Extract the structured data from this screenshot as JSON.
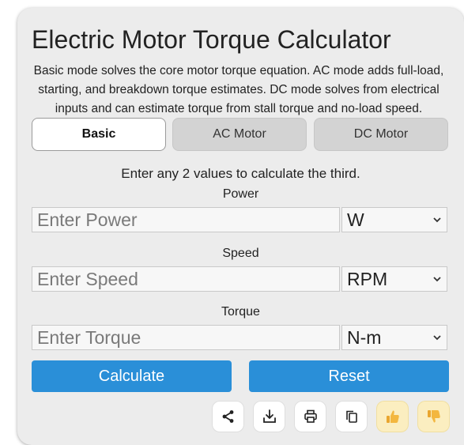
{
  "title": "Electric Motor Torque Calculator",
  "description": "Basic mode solves the core motor torque equation. AC mode adds full-load, starting, and breakdown torque estimates. DC mode solves from electrical inputs and can estimate torque from stall torque and no-load speed.",
  "tabs": [
    {
      "label": "Basic",
      "active": true
    },
    {
      "label": "AC Motor",
      "active": false
    },
    {
      "label": "DC Motor",
      "active": false
    }
  ],
  "hint": "Enter any 2 values to calculate the third.",
  "fields": {
    "power": {
      "label": "Power",
      "placeholder": "Enter Power",
      "value": "",
      "unit": "W"
    },
    "speed": {
      "label": "Speed",
      "placeholder": "Enter Speed",
      "value": "",
      "unit": "RPM"
    },
    "torque": {
      "label": "Torque",
      "placeholder": "Enter Torque",
      "value": "",
      "unit": "N-m"
    }
  },
  "buttons": {
    "calculate": "Calculate",
    "reset": "Reset"
  },
  "icons": [
    "share-icon",
    "download-icon",
    "print-icon",
    "copy-icon",
    "thumbs-up-icon",
    "thumbs-down-icon"
  ],
  "colors": {
    "accent": "#2a8fd8",
    "card": "#ececec",
    "thumb_bg": "#fbeec0",
    "thumb_icon": "#f0b43c"
  }
}
